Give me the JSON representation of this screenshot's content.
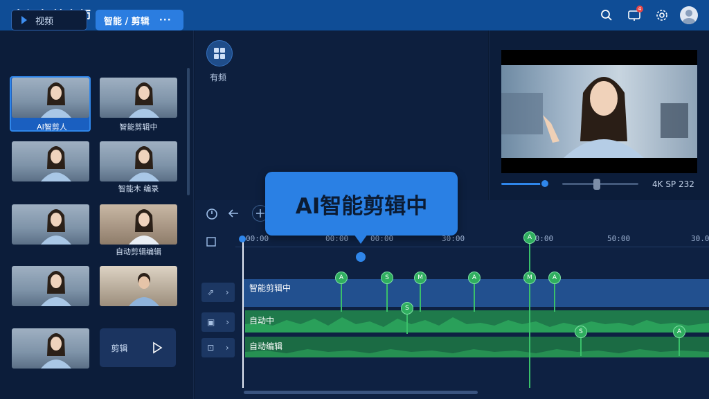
{
  "header": {
    "title": "音视频剪大师",
    "notification_count": "4"
  },
  "left_panel": {
    "tab_video": "视频",
    "tab_smart": "智能 / 剪辑",
    "tab_more": "···",
    "thumb_labels": [
      "AI智剪人",
      "智能剪辑中",
      "智能木 编录",
      "自动剪辑编辑"
    ],
    "play_card_label": "剪辑"
  },
  "center": {
    "grid_label": "有频"
  },
  "preview": {
    "resolution": "4K SP 232",
    "progress_fraction": 0.23,
    "volume_fraction": 0.45
  },
  "timeline": {
    "tooltip": "AI智能剪辑中",
    "ruler_labels": [
      "00:00",
      "00:00",
      "00:00",
      "30:00",
      "40:00",
      "50:00",
      "30.0"
    ],
    "tracks": [
      {
        "label": "智能剪辑中"
      },
      {
        "label": "自动中"
      },
      {
        "label": "自动编辑"
      }
    ],
    "marker_glyphs": [
      "A",
      "S",
      "M",
      "A",
      "A",
      "M",
      "A",
      "S",
      "S",
      "A"
    ]
  }
}
